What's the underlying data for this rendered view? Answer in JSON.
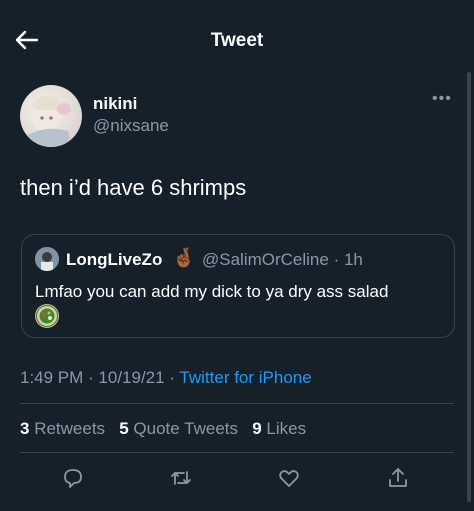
{
  "header": {
    "title": "Tweet"
  },
  "tweet": {
    "name": "nikini",
    "handle": "@nixsane",
    "text": "then i’d have 6 shrimps",
    "meta": {
      "time": "1:49 PM",
      "sep1": " · ",
      "date": "10/19/21",
      "sep2": " · ",
      "source": "Twitter for iPhone"
    },
    "stats": {
      "retweets_count": "3",
      "retweets_label": " Retweets",
      "quotes_count": "5",
      "quotes_label": " Quote Tweets",
      "likes_count": "9",
      "likes_label": " Likes"
    }
  },
  "quoted": {
    "name": "LongLiveZo",
    "name_emoji": "🤞🏾",
    "handle": "@SalimOrCeline",
    "time": " · 1h",
    "text": "Lmfao you can add my dick to ya dry ass salad"
  },
  "actions": [
    "reply-icon",
    "retweet-icon",
    "like-icon",
    "share-icon"
  ],
  "colors": {
    "background": "#15202b",
    "accent": "#1d9bf0",
    "secondary_text": "#8899a6",
    "border": "#38444d"
  }
}
